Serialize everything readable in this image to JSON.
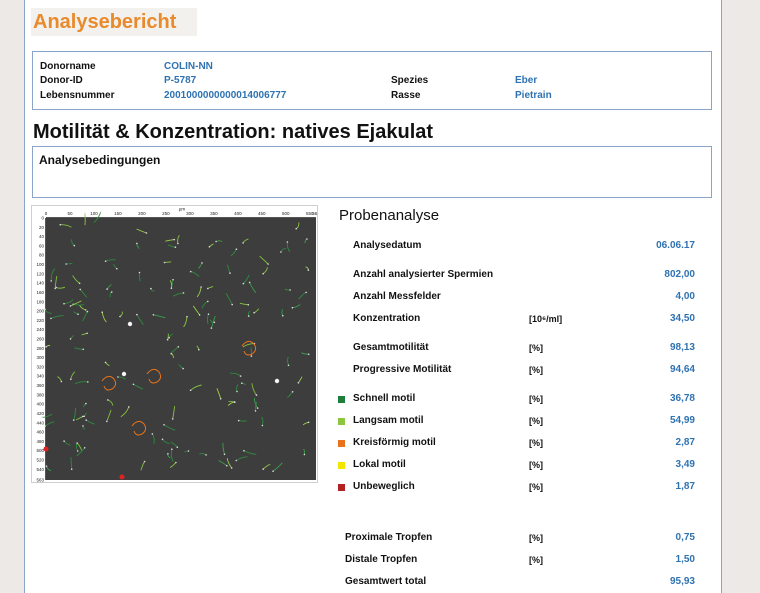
{
  "report": {
    "title": "Analysebericht"
  },
  "donor": {
    "name_label": "Donorname",
    "name_value": "COLIN-NN",
    "id_label": "Donor-ID",
    "id_value": "P-5787",
    "life_label": "Lebensnummer",
    "life_value": "2001000000000014006777",
    "species_label": "Spezies",
    "species_value": "Eber",
    "breed_label": "Rasse",
    "breed_value": "Pietrain"
  },
  "section": {
    "title": "Motilität & Konzentration: natives Ejakulat"
  },
  "conditions": {
    "title": "Analysebedingungen"
  },
  "image": {
    "unit_label": "µm",
    "x_ticks": [
      "0",
      "50",
      "100",
      "150",
      "200",
      "250",
      "300",
      "350",
      "400",
      "450",
      "500",
      "550",
      "563"
    ],
    "y_ticks": [
      "0",
      "20",
      "40",
      "60",
      "80",
      "100",
      "120",
      "140",
      "160",
      "180",
      "200",
      "220",
      "240",
      "260",
      "280",
      "300",
      "320",
      "340",
      "360",
      "380",
      "400",
      "420",
      "440",
      "460",
      "480",
      "500",
      "520",
      "540",
      "563"
    ]
  },
  "analysis": {
    "title": "Probenanalyse",
    "rows": [
      {
        "label": "Analysedatum",
        "unit": "",
        "value": "06.06.17"
      },
      {
        "label": "Anzahl analysierter Spermien",
        "unit": "",
        "value": "802,00"
      },
      {
        "label": "Anzahl Messfelder",
        "unit": "",
        "value": "4,00"
      },
      {
        "label": "Konzentration",
        "unit": "[10⁶/ml]",
        "value": "34,50"
      },
      {
        "label": "Gesamtmotilität",
        "unit": "[%]",
        "value": "98,13"
      },
      {
        "label": "Progressive Motilität",
        "unit": "[%]",
        "value": "94,64"
      },
      {
        "label": "Schnell motil",
        "unit": "[%]",
        "value": "36,78",
        "color": "#1e7f3a"
      },
      {
        "label": "Langsam motil",
        "unit": "[%]",
        "value": "54,99",
        "color": "#8cc63f"
      },
      {
        "label": "Kreisförmig motil",
        "unit": "[%]",
        "value": "2,87",
        "color": "#e8731a"
      },
      {
        "label": "Lokal motil",
        "unit": "[%]",
        "value": "3,49",
        "color": "#f2e600"
      },
      {
        "label": "Unbeweglich",
        "unit": "[%]",
        "value": "1,87",
        "color": "#b22222"
      },
      {
        "label": "Proximale Tropfen",
        "unit": "[%]",
        "value": "0,75"
      },
      {
        "label": "Distale Tropfen",
        "unit": "[%]",
        "value": "1,50"
      },
      {
        "label": "Gesamtwert total",
        "unit": "",
        "value": "95,93"
      }
    ]
  }
}
